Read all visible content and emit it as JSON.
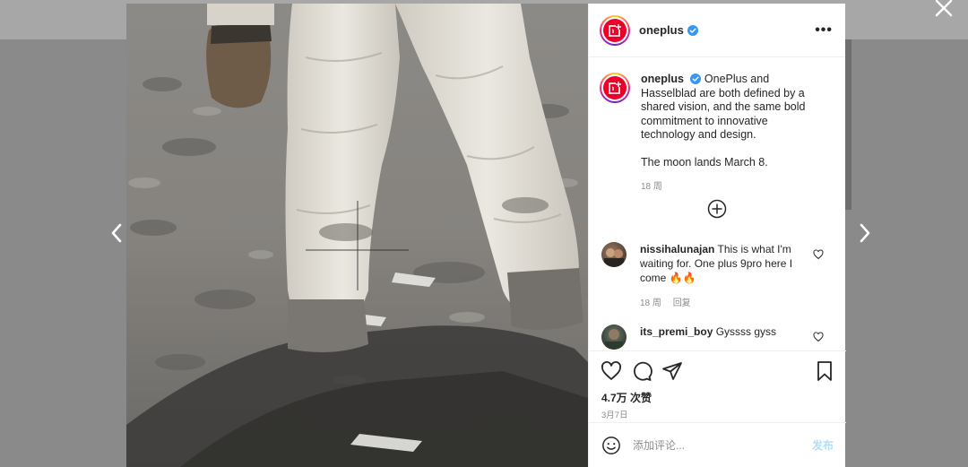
{
  "post": {
    "username": "oneplus",
    "caption_p1": "OnePlus and Hasselblad are both defined by a shared vision, and the same bold commitment to innovative technology and design.",
    "caption_p2": "The moon lands March 8.",
    "caption_age": "18 周",
    "more_label": "•••",
    "likes": "4.7万 次赞",
    "date": "3月7日"
  },
  "comments": [
    {
      "username": "nissihalunajan",
      "text": "This is what I'm waiting for. One plus 9pro here I come 🔥🔥",
      "age": "18 周",
      "reply_label": "回复"
    },
    {
      "username": "its_premi_boy",
      "text": "Gyssss gyss"
    }
  ],
  "composer": {
    "placeholder": "添加评论...",
    "post_label": "发布"
  },
  "icons": {
    "close": "close-icon",
    "prev": "chevron-left-icon",
    "next": "chevron-right-icon",
    "verified": "verified-badge-icon",
    "more": "more-options-icon",
    "load_more": "plus-circle-icon",
    "like": "heart-icon",
    "comment": "comment-bubble-icon",
    "share": "paper-plane-icon",
    "save": "bookmark-icon",
    "emoji": "emoji-icon"
  },
  "colors": {
    "brand_red": "#eb0029",
    "verified_blue": "#3897f0",
    "post_button": "#b2dffc",
    "muted_text": "#8e8e8e"
  }
}
